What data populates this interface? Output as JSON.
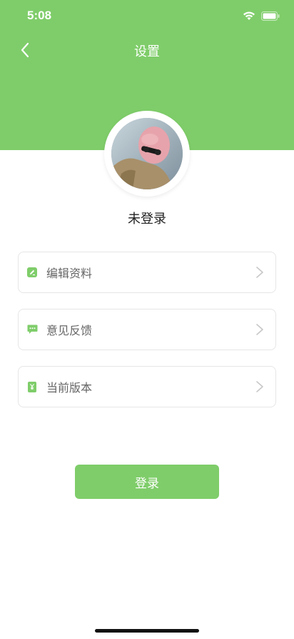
{
  "status_bar": {
    "time": "5:08"
  },
  "nav": {
    "title": "设置"
  },
  "profile": {
    "username": "未登录"
  },
  "menu": [
    {
      "label": "编辑资料",
      "icon": "edit-icon"
    },
    {
      "label": "意见反馈",
      "icon": "feedback-icon"
    },
    {
      "label": "当前版本",
      "icon": "version-icon"
    }
  ],
  "login_button": {
    "label": "登录"
  },
  "colors": {
    "accent": "#7fcd6a",
    "background": "#ffffff"
  }
}
